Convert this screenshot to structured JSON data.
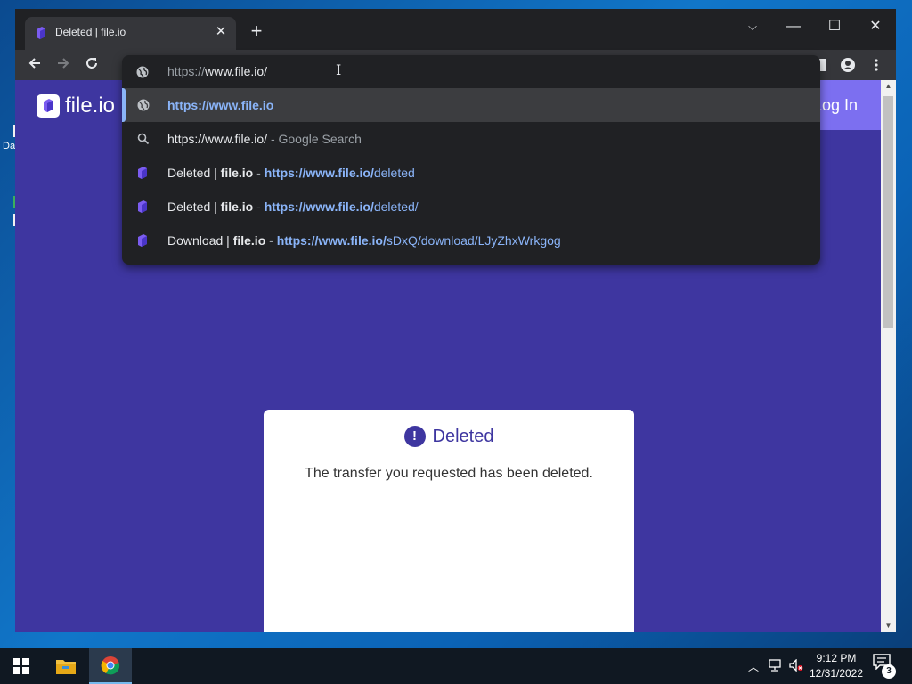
{
  "desktop": {
    "icon_label_fragment": "Da"
  },
  "browser": {
    "tab": {
      "title": "Deleted | file.io",
      "favicon": "fileio-logo-icon"
    },
    "window_controls": {
      "tab_search": "⌵",
      "minimize": "—",
      "maximize": "☐",
      "close": "✕"
    },
    "omnibox": {
      "scheme": "https://",
      "host_path": "www.file.io/",
      "suggestions": [
        {
          "icon": "globe-icon",
          "title": "",
          "url_bold": "https://www.file.io",
          "url_rest": "",
          "selected": true
        },
        {
          "icon": "search-icon",
          "query": "https://www.file.io/",
          "suffix": "- Google Search"
        },
        {
          "icon": "fileio-logo-icon",
          "title_plain": "Deleted | ",
          "title_bold": "file.io",
          "sep": " - ",
          "url_bold": "https://www.file.io/",
          "url_rest": "deleted"
        },
        {
          "icon": "fileio-logo-icon",
          "title_plain": "Deleted | ",
          "title_bold": "file.io",
          "sep": " - ",
          "url_bold": "https://www.file.io/",
          "url_rest": "deleted/"
        },
        {
          "icon": "fileio-logo-icon",
          "title_plain": "Download | ",
          "title_bold": "file.io",
          "sep": " - ",
          "url_bold": "https://www.file.io/",
          "url_rest": "sDxQ/download/LJyZhxWrkgog"
        }
      ]
    }
  },
  "page": {
    "logo_text": "file.io",
    "login_label": "Log In",
    "card": {
      "title": "Deleted",
      "icon_glyph": "!",
      "message": "The transfer you requested has been deleted."
    },
    "colors": {
      "background": "#3e36a0",
      "accent": "#7c6ff0"
    }
  },
  "taskbar": {
    "time": "9:12 PM",
    "date": "12/31/2022",
    "notification_count": "3",
    "apps": [
      "windows-start-icon",
      "file-explorer-icon",
      "chrome-icon"
    ]
  }
}
